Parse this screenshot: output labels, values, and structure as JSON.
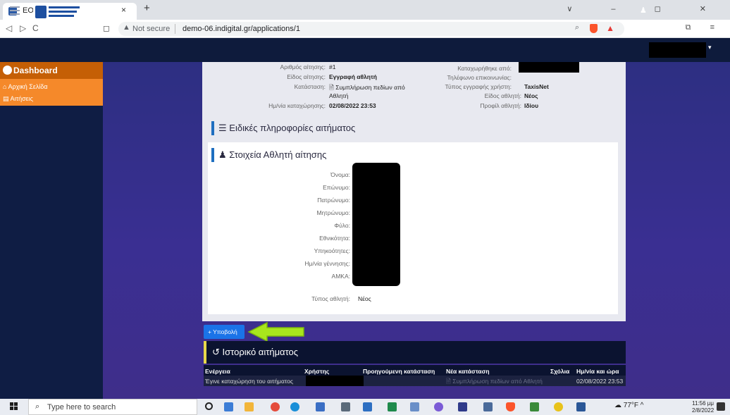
{
  "browser": {
    "tab_title": "EOK DEMO",
    "tab_close": "×",
    "new_tab": "+",
    "not_secure": "Not secure",
    "url": "demo-06.indigital.gr/applications/1",
    "window_controls": "∨ – ◻ ✕",
    "nav": {
      "back": "◁",
      "forward": "▷",
      "reload": "C",
      "bookmark": "◻"
    }
  },
  "sidebar": {
    "dashboard": "Dashboard",
    "items": [
      {
        "label": "Αρχική Σελίδα"
      },
      {
        "label": "Αιτήσεις"
      }
    ]
  },
  "application_info": {
    "left": [
      {
        "label": "Αριθμός αίτησης:",
        "value": "#1",
        "bold": false
      },
      {
        "label": "Είδος αίτησης:",
        "value": "Εγγραφή αθλητή",
        "bold": true
      },
      {
        "label": "Κατάσταση:",
        "value": "Συμπλήρωση πεδίων από Αθλητή",
        "bold": false
      },
      {
        "label": "Ημ/νία καταχώρησης:",
        "value": "02/08/2022 23:53",
        "bold": true
      }
    ],
    "right": [
      {
        "label": "Καταχωρήθηκε από:",
        "value": ""
      },
      {
        "label": "Τηλέφωνο επικοινωνίας:",
        "value": ""
      },
      {
        "label": "Τύπος εγγραφής χρήστη:",
        "value": "TaxisNet"
      },
      {
        "label": "Είδος αθλητή:",
        "value": "Νέος"
      },
      {
        "label": "Προφίλ αθλητή:",
        "value": "Ιδίου"
      }
    ]
  },
  "special_info_heading": "Ειδικές πληροφορίες αιτήματος",
  "athlete": {
    "heading": "Στοιχεία Αθλητή αίτησης",
    "fields": [
      {
        "label": "Όνομα:",
        "value": ""
      },
      {
        "label": "Επώνυμο:",
        "value": ""
      },
      {
        "label": "Πατρώνυμο:",
        "value": ""
      },
      {
        "label": "Μητρώνυμο:",
        "value": ""
      },
      {
        "label": "Φύλο:",
        "value": ""
      },
      {
        "label": "Εθνικότητα:",
        "value": ""
      },
      {
        "label": "Υπηκοότητες:",
        "value": ""
      },
      {
        "label": "Ημ/νία γέννησης:",
        "value": ""
      },
      {
        "label": "ΑΜΚΑ:",
        "value": ""
      },
      {
        "label": "Τύπος αθλητή:",
        "value": "Νέος"
      }
    ]
  },
  "submit_label": "+ Υποβολή",
  "history": {
    "heading": "Ιστορικό αιτήματος",
    "columns": [
      "Ενέργεια",
      "Χρήστης",
      "Προηγούμενη κατάσταση",
      "Νέα κατάσταση",
      "Σχόλια",
      "Ημ/νία και ώρα"
    ],
    "rows": [
      {
        "action": "Έγινε καταχώρηση του αιτήματος",
        "user": "",
        "previous": "",
        "new": "Συμπλήρωση πεδίων από Αθλητή",
        "comments": "",
        "datetime": "02/08/2022 23:53"
      }
    ]
  },
  "taskbar": {
    "search_placeholder": "Type here to search",
    "weather": "77°F",
    "time": "11:56 μμ",
    "date": "2/8/2022",
    "colors": {
      "accent_orange": "#c55f05",
      "sidebar_orange": "#f5892a",
      "topbar": "#0e1b3c",
      "arrow_green": "#a8e61d"
    }
  }
}
